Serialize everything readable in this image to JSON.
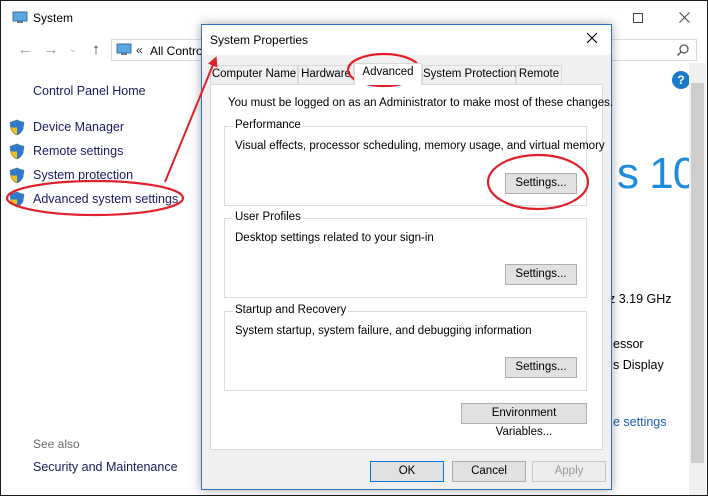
{
  "background_window": {
    "title": "System",
    "address_separator": "«",
    "address_text": "All Control Panel Items",
    "control_panel_home": "Control Panel Home",
    "sidebar_items": [
      {
        "label": "Device Manager"
      },
      {
        "label": "Remote settings"
      },
      {
        "label": "System protection"
      },
      {
        "label": "Advanced system settings"
      }
    ],
    "see_also": "See also",
    "security_maintenance": "Security and Maintenance",
    "help_label": "?",
    "windows_version_fragment": "s 10",
    "cpu_speed_fragment": "z  3.19 GHz",
    "processor_fragment": "essor",
    "display_fragment": "s Display",
    "change_settings_fragment": "e settings"
  },
  "dialog": {
    "title": "System Properties",
    "tabs": [
      {
        "label": "Computer Name"
      },
      {
        "label": "Hardware"
      },
      {
        "label": "Advanced"
      },
      {
        "label": "System Protection"
      },
      {
        "label": "Remote"
      }
    ],
    "admin_note": "You must be logged on as an Administrator to make most of these changes.",
    "groups": {
      "performance": {
        "title": "Performance",
        "desc": "Visual effects, processor scheduling, memory usage, and virtual memory",
        "button": "Settings..."
      },
      "user_profiles": {
        "title": "User Profiles",
        "desc": "Desktop settings related to your sign-in",
        "button": "Settings..."
      },
      "startup_recovery": {
        "title": "Startup and Recovery",
        "desc": "System startup, system failure, and debugging information",
        "button": "Settings..."
      }
    },
    "env_vars_button": "Environment Variables...",
    "ok_button": "OK",
    "cancel_button": "Cancel",
    "apply_button": "Apply"
  },
  "colors": {
    "annotation_red": "#e0202a",
    "link_blue": "#1a1a60",
    "accent_blue": "#1c8be0",
    "dialog_border": "#2b74c4"
  }
}
